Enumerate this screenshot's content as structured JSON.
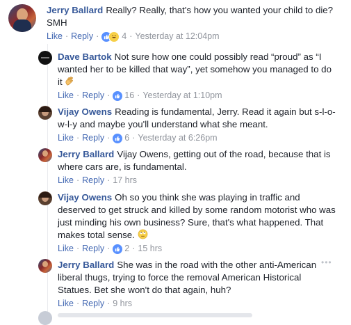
{
  "comments": [
    {
      "author": "Jerry Ballard",
      "text": "Really? Really, that's how you wanted your child to die? SMH",
      "actions": {
        "like": "Like",
        "reply": "Reply",
        "reactions_count": "4",
        "time": "Yesterday at 12:04pm"
      },
      "reactions": [
        "like-icon",
        "haha-icon"
      ]
    },
    {
      "author": "Dave Bartok",
      "text": "Not sure how one could possibly read “proud” as “I wanted her to be killed that way”, yet somehow you managed to do it",
      "emoji": "clapping-hand-icon",
      "actions": {
        "like": "Like",
        "reply": "Reply",
        "reactions_count": "16",
        "time": "Yesterday at 1:10pm"
      },
      "reactions": [
        "like-icon"
      ]
    },
    {
      "author": "Vijay Owens",
      "text": "Reading is fundamental, Jerry. Read it again but s-l-o-w-l-y and maybe you'll understand what she meant.",
      "actions": {
        "like": "Like",
        "reply": "Reply",
        "reactions_count": "6",
        "time": "Yesterday at 6:26pm"
      },
      "reactions": [
        "like-icon"
      ]
    },
    {
      "author": "Jerry Ballard",
      "text": "Vijay Owens, getting out of the road, because that is where cars are, is fundamental.",
      "actions": {
        "like": "Like",
        "reply": "Reply",
        "time": "17 hrs"
      }
    },
    {
      "author": "Vijay Owens",
      "text": "Oh so you think she was playing in traffic and deserved to get struck and killed by some random motorist who was just minding his own business? Sure, that's what happened. That makes total sense.",
      "emoji": "rolling-eyes-icon",
      "actions": {
        "like": "Like",
        "reply": "Reply",
        "reactions_count": "2",
        "time": "15 hrs"
      },
      "reactions": [
        "like-icon"
      ]
    },
    {
      "author": "Jerry Ballard",
      "text": "She was in the road with the other anti-American liberal thugs, trying to force the removal American Historical Statues. Bet she won't do that again, huh?",
      "actions": {
        "like": "Like",
        "reply": "Reply",
        "time": "9 hrs"
      }
    }
  ],
  "colors": {
    "link": "#365899",
    "action_link": "#4267b2",
    "meta": "#90949c",
    "like_blue": "#5890ff"
  }
}
